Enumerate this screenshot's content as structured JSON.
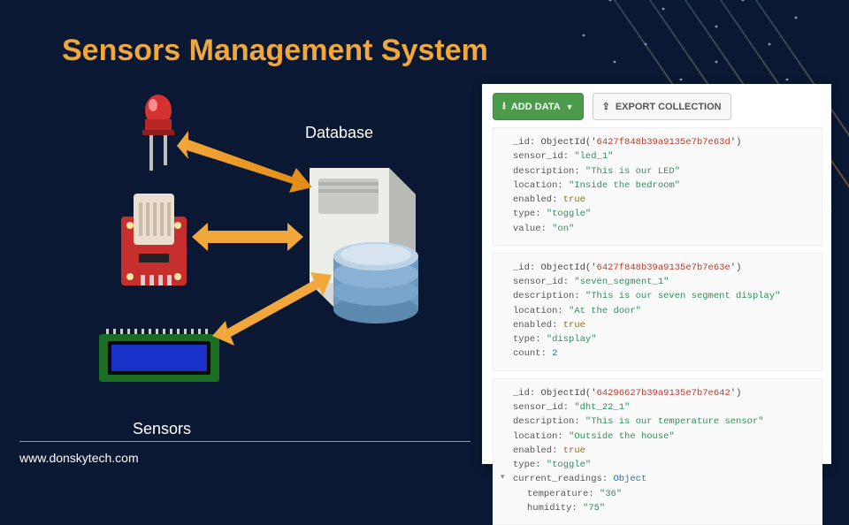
{
  "title": "Sensors Management System",
  "labels": {
    "database": "Database",
    "sensors": "Sensors"
  },
  "footer": "www.donskytech.com",
  "panel": {
    "buttons": {
      "add_data": "ADD DATA",
      "export_collection": "EXPORT COLLECTION"
    },
    "documents": [
      {
        "_id": "ObjectId('6427f848b39a9135e7b7e63d')",
        "fields": [
          {
            "key": "sensor_id",
            "type": "str",
            "value": "\"led_1\""
          },
          {
            "key": "description",
            "type": "str",
            "value": "\"This is our LED\""
          },
          {
            "key": "location",
            "type": "str",
            "value": "\"Inside the bedroom\""
          },
          {
            "key": "enabled",
            "type": "kw",
            "value": "true"
          },
          {
            "key": "type",
            "type": "str",
            "value": "\"toggle\""
          },
          {
            "key": "value",
            "type": "str",
            "value": "\"on\""
          }
        ]
      },
      {
        "_id": "ObjectId('6427f848b39a9135e7b7e63e')",
        "fields": [
          {
            "key": "sensor_id",
            "type": "str",
            "value": "\"seven_segment_1\""
          },
          {
            "key": "description",
            "type": "str",
            "value": "\"This is our seven segment display\""
          },
          {
            "key": "location",
            "type": "str",
            "value": "\"At the door\""
          },
          {
            "key": "enabled",
            "type": "kw",
            "value": "true"
          },
          {
            "key": "type",
            "type": "str",
            "value": "\"display\""
          },
          {
            "key": "count",
            "type": "num",
            "value": "2"
          }
        ]
      },
      {
        "_id": "ObjectId('64296627b39a9135e7b7e642')",
        "fields": [
          {
            "key": "sensor_id",
            "type": "str",
            "value": "\"dht_22_1\""
          },
          {
            "key": "description",
            "type": "str",
            "value": "\"This is our temperature sensor\""
          },
          {
            "key": "location",
            "type": "str",
            "value": "\"Outside the house\""
          },
          {
            "key": "enabled",
            "type": "kw",
            "value": "true"
          },
          {
            "key": "type",
            "type": "str",
            "value": "\"toggle\""
          },
          {
            "key": "current_readings",
            "type": "obj",
            "value": "Object",
            "expandable": true,
            "children": [
              {
                "key": "temperature",
                "type": "str",
                "value": "\"36\""
              },
              {
                "key": "humidity",
                "type": "str",
                "value": "\"75\""
              }
            ]
          }
        ]
      }
    ]
  }
}
